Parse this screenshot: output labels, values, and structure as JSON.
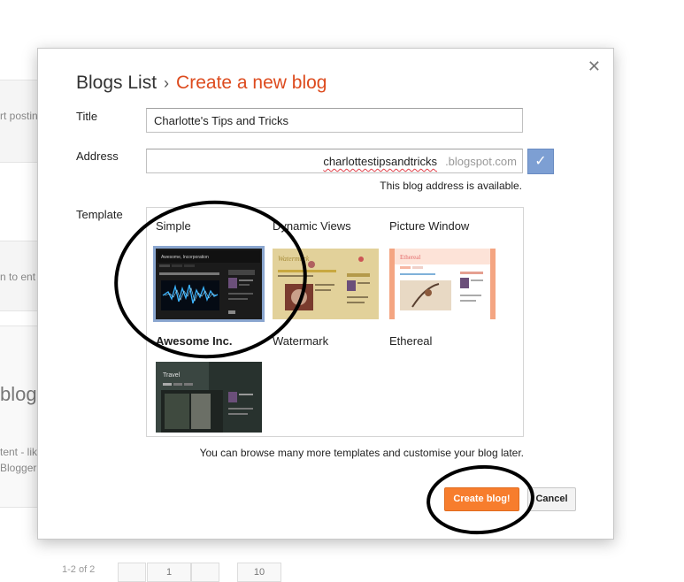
{
  "background": {
    "texts": [
      "rt postin",
      "n to ent",
      "blog",
      "tent - lik",
      "Blogger",
      "1-2 of 2",
      "1",
      "10"
    ]
  },
  "dialog": {
    "close_label": "✕",
    "breadcrumb": {
      "home": "Blogs List",
      "separator": "›",
      "current": "Create a new blog"
    },
    "title_label": "Title",
    "title_value": "Charlotte's Tips and Tricks",
    "address_label": "Address",
    "address_value": "charlottestipsandtricks",
    "address_suffix": ".blogspot.com",
    "address_status": "This blog address is available.",
    "check_icon": "✓",
    "template_label": "Template",
    "templates": [
      {
        "name": "Simple",
        "variant": "Awesome Inc.",
        "selected": true
      },
      {
        "name": "Dynamic Views",
        "variant": "Watermark"
      },
      {
        "name": "Picture Window",
        "variant": "Ethereal"
      }
    ],
    "thumb_texts": {
      "awesome_title": "Awesome, Incorporation",
      "watermark_title": "Watermark",
      "ethereal_title": "Ethereal",
      "travel_title": "Travel"
    },
    "hint": "You can browse many more templates and customise your blog later.",
    "create_button": "Create blog!",
    "cancel_button": "Cancel"
  },
  "colors": {
    "accent": "#dd4b1e",
    "create_button": "#f77d2d",
    "check_button": "#7d9fd3",
    "selection_outline": "#8aa6cf"
  }
}
